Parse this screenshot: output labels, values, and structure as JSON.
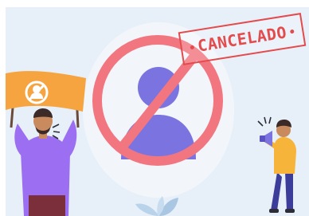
{
  "illustration": {
    "stamp_text": "CANCELADO",
    "colors": {
      "background": "#e7f0f9",
      "ban_ring": "#f2767f",
      "silhouette": "#7b73e0",
      "stamp_red": "#e34b4d",
      "banner_orange": "#f6a43f",
      "shirt_purple": "#9c6ef2",
      "shirt_yellow": "#f6b43a"
    },
    "icons": [
      "ban-sign-icon",
      "user-silhouette-icon",
      "megaphone-icon",
      "leaf-icon"
    ]
  }
}
